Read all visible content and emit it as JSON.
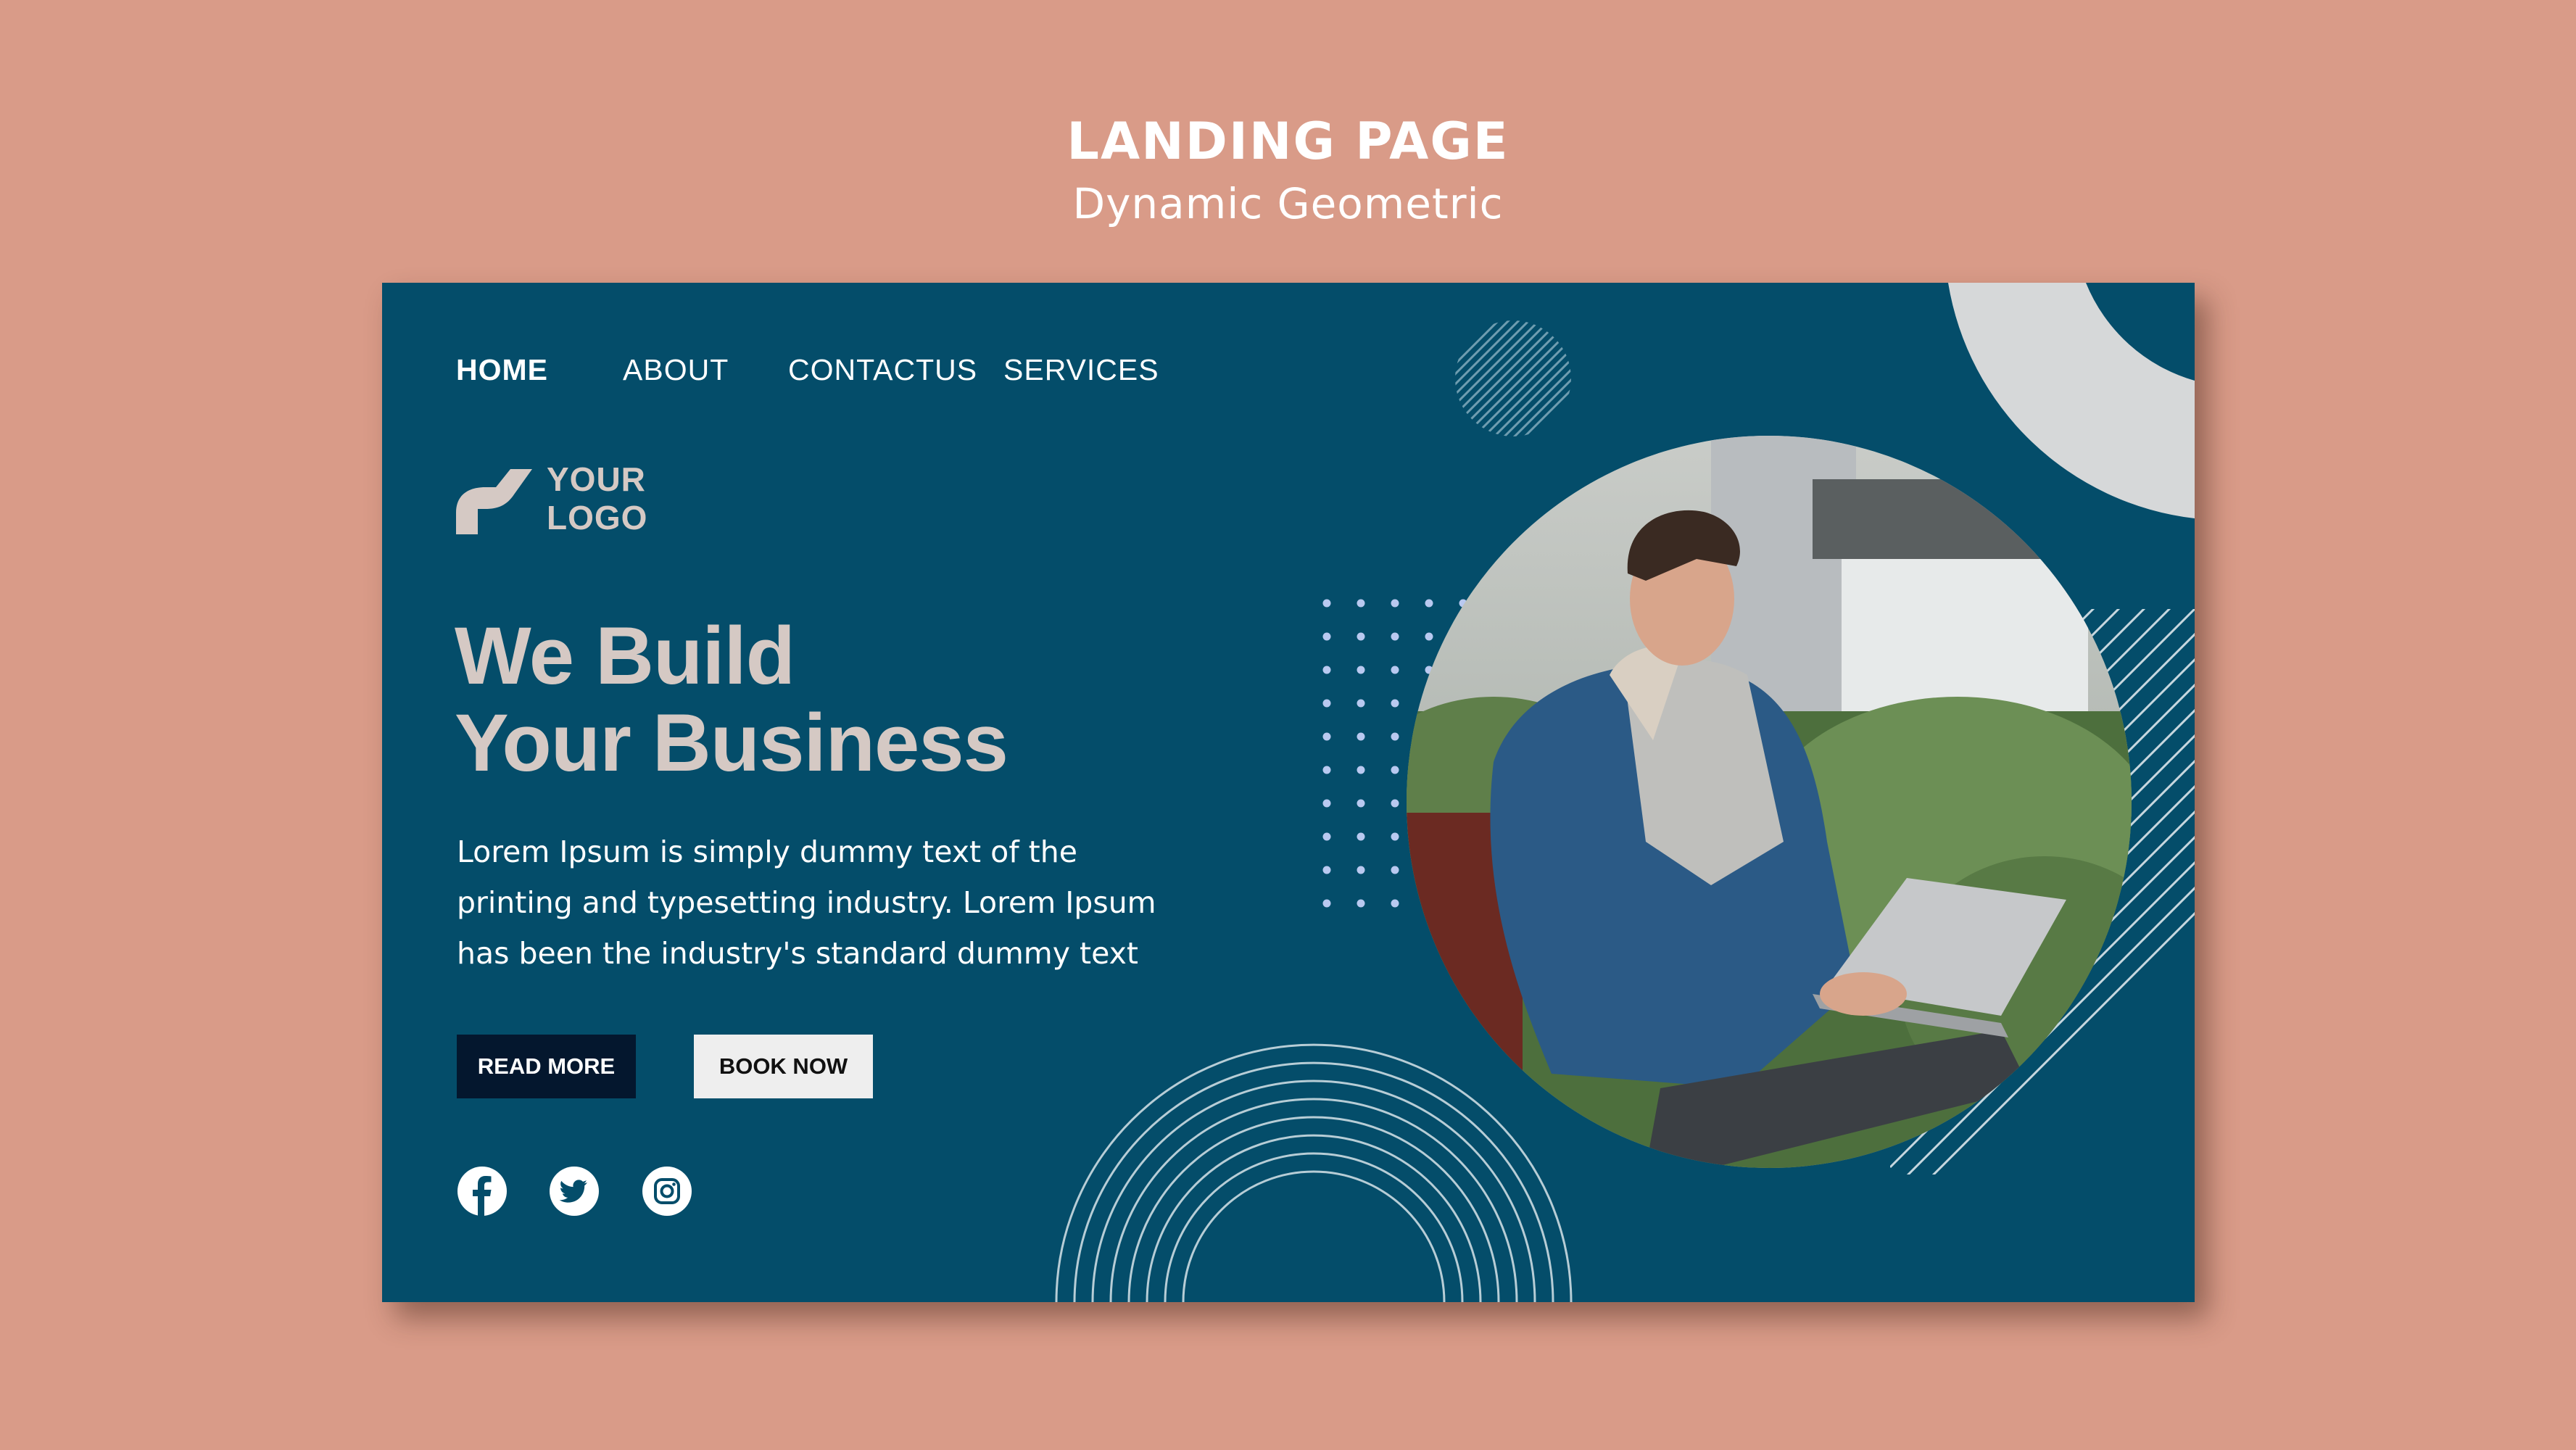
{
  "header": {
    "title": "LANDING PAGE",
    "subtitle": "Dynamic Geometric"
  },
  "nav": {
    "items": [
      {
        "label": "HOME"
      },
      {
        "label": "ABOUT"
      },
      {
        "label": "CONTACTUS"
      },
      {
        "label": "SERVICES"
      }
    ]
  },
  "logo": {
    "line1": "YOUR",
    "line2": "LOGO"
  },
  "hero": {
    "headline_line1": "We Build",
    "headline_line2": "Your Business",
    "body_line1": "Lorem Ipsum is simply dummy text of the",
    "body_line2": "printing and typesetting industry. Lorem Ipsum",
    "body_line3": "has been the industry's standard dummy text"
  },
  "buttons": {
    "read_more": "READ MORE",
    "book_now": "BOOK NOW"
  },
  "social": [
    "facebook-icon",
    "twitter-icon",
    "instagram-icon"
  ],
  "colors": {
    "background": "#d99b88",
    "panel": "#044d6a",
    "accent_light": "#d5c9c4",
    "button_dark": "#04172e"
  }
}
